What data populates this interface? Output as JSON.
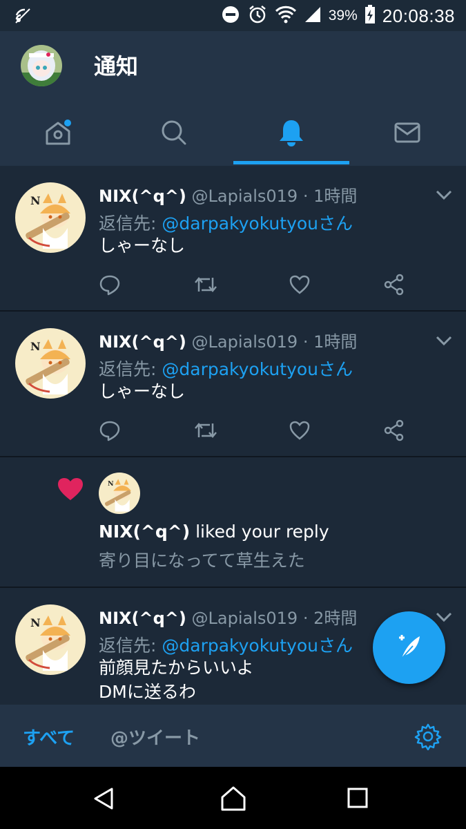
{
  "status_bar": {
    "battery_percent": "39%",
    "time": "20:08:38"
  },
  "header": {
    "title": "通知"
  },
  "tabs": [
    {
      "name": "home",
      "icon": "home-icon",
      "has_dot": true
    },
    {
      "name": "search",
      "icon": "search-icon"
    },
    {
      "name": "notifications",
      "icon": "bell-icon",
      "active": true
    },
    {
      "name": "messages",
      "icon": "mail-icon"
    }
  ],
  "notifications": [
    {
      "type": "reply",
      "name": "NIX(^q^)",
      "handle": "@Lapials019",
      "time": "· 1時間",
      "reply_label": "返信先:",
      "reply_to": "@darpakyokutyouさん",
      "text": "しゃーなし"
    },
    {
      "type": "reply",
      "name": "NIX(^q^)",
      "handle": "@Lapials019",
      "time": "· 1時間",
      "reply_label": "返信先:",
      "reply_to": "@darpakyokutyouさん",
      "text": "しゃーなし"
    },
    {
      "type": "like",
      "name": "NIX(^q^)",
      "action": "liked your reply",
      "text": "寄り目になってて草生えた"
    },
    {
      "type": "reply",
      "name": "NIX(^q^)",
      "handle": "@Lapials019",
      "time": "· 2時間",
      "reply_label": "返信先:",
      "reply_to": "@darpakyokutyouさん",
      "text_line1": "前顔見たからいいよ",
      "text_line2": "DMに送るわ"
    }
  ],
  "bottom_tabs": {
    "all_label": "すべて",
    "mentions_label": "@ツイート"
  },
  "colors": {
    "accent": "#1da1f2",
    "background": "#15202b",
    "card": "#1c2938",
    "header": "#243447",
    "secondary_text": "#8899a6",
    "like_heart": "#e0245e"
  }
}
